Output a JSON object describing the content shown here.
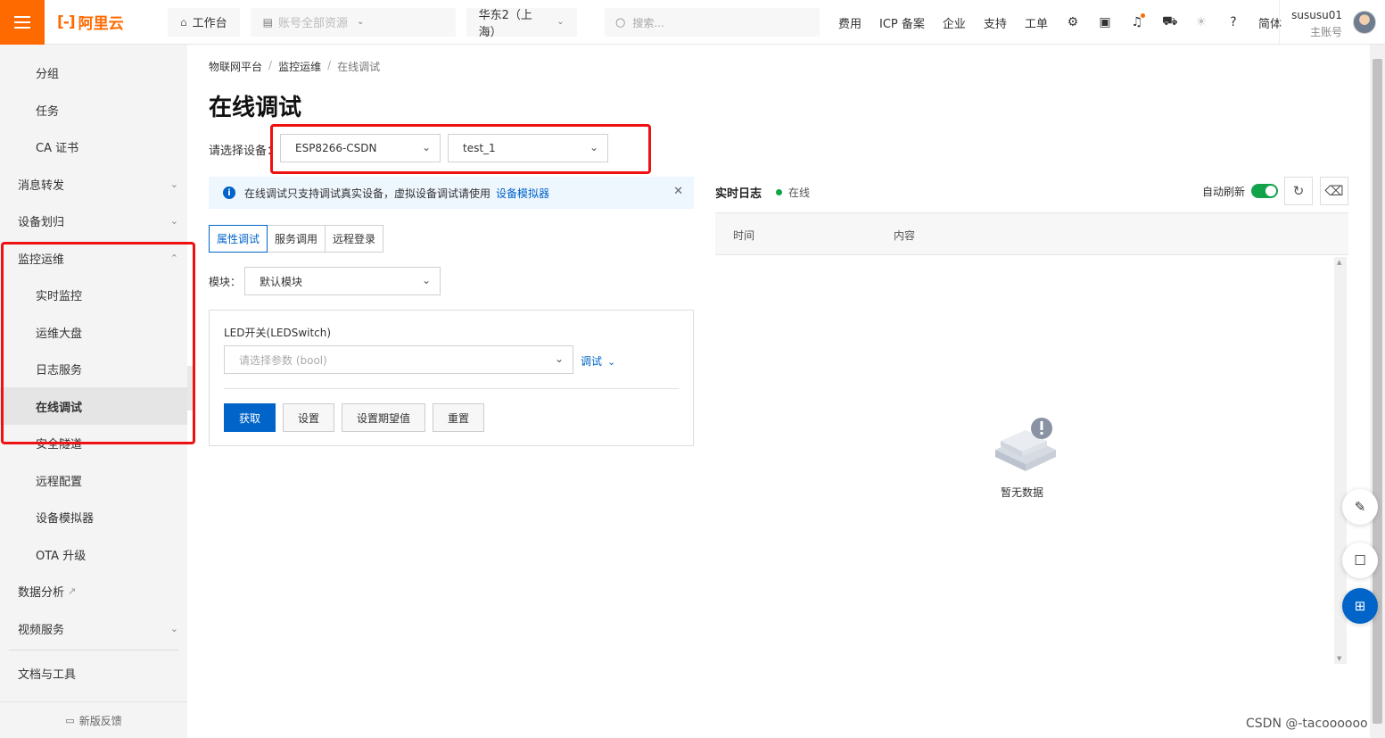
{
  "topbar": {
    "logo_text": "阿里云",
    "workbench": "工作台",
    "resources": "账号全部资源",
    "region": "华东2（上海）",
    "search_placeholder": "搜索...",
    "nav": [
      "费用",
      "ICP 备案",
      "企业",
      "支持",
      "工单"
    ],
    "lang": "简体",
    "user_name": "sususu01",
    "user_role": "主账号"
  },
  "sidebar": {
    "items": [
      {
        "label": "分组"
      },
      {
        "label": "任务"
      },
      {
        "label": "CA 证书"
      },
      {
        "label": "消息转发"
      },
      {
        "label": "设备划归"
      },
      {
        "label": "监控运维"
      },
      {
        "label": "实时监控"
      },
      {
        "label": "运维大盘"
      },
      {
        "label": "日志服务"
      },
      {
        "label": "在线调试"
      },
      {
        "label": "安全隧道"
      },
      {
        "label": "远程配置"
      },
      {
        "label": "设备模拟器"
      },
      {
        "label": "OTA 升级"
      },
      {
        "label": "数据分析"
      },
      {
        "label": "视频服务"
      },
      {
        "label": "文档与工具"
      }
    ],
    "feedback": "新版反馈"
  },
  "breadcrumb": [
    "物联网平台",
    "监控运维",
    "在线调试"
  ],
  "page_title": "在线调试",
  "device": {
    "label": "请选择设备：",
    "product": "ESP8266-CSDN",
    "device_name": "test_1"
  },
  "notice": {
    "text": "在线调试只支持调试真实设备，虚拟设备调试请使用",
    "link": "设备模拟器"
  },
  "tabs": [
    "属性调试",
    "服务调用",
    "远程登录"
  ],
  "module": {
    "label": "模块：",
    "value": "默认模块"
  },
  "property": {
    "label": "LED开关(LEDSwitch)",
    "placeholder": "请选择参数 (bool)",
    "debug": "调试"
  },
  "buttons": [
    "获取",
    "设置",
    "设置期望值",
    "重置"
  ],
  "log": {
    "title": "实时日志",
    "status": "在线",
    "auto_refresh": "自动刷新",
    "col_time": "时间",
    "col_content": "内容",
    "empty": "暂无数据"
  },
  "watermark": "CSDN @-tacoooooo"
}
